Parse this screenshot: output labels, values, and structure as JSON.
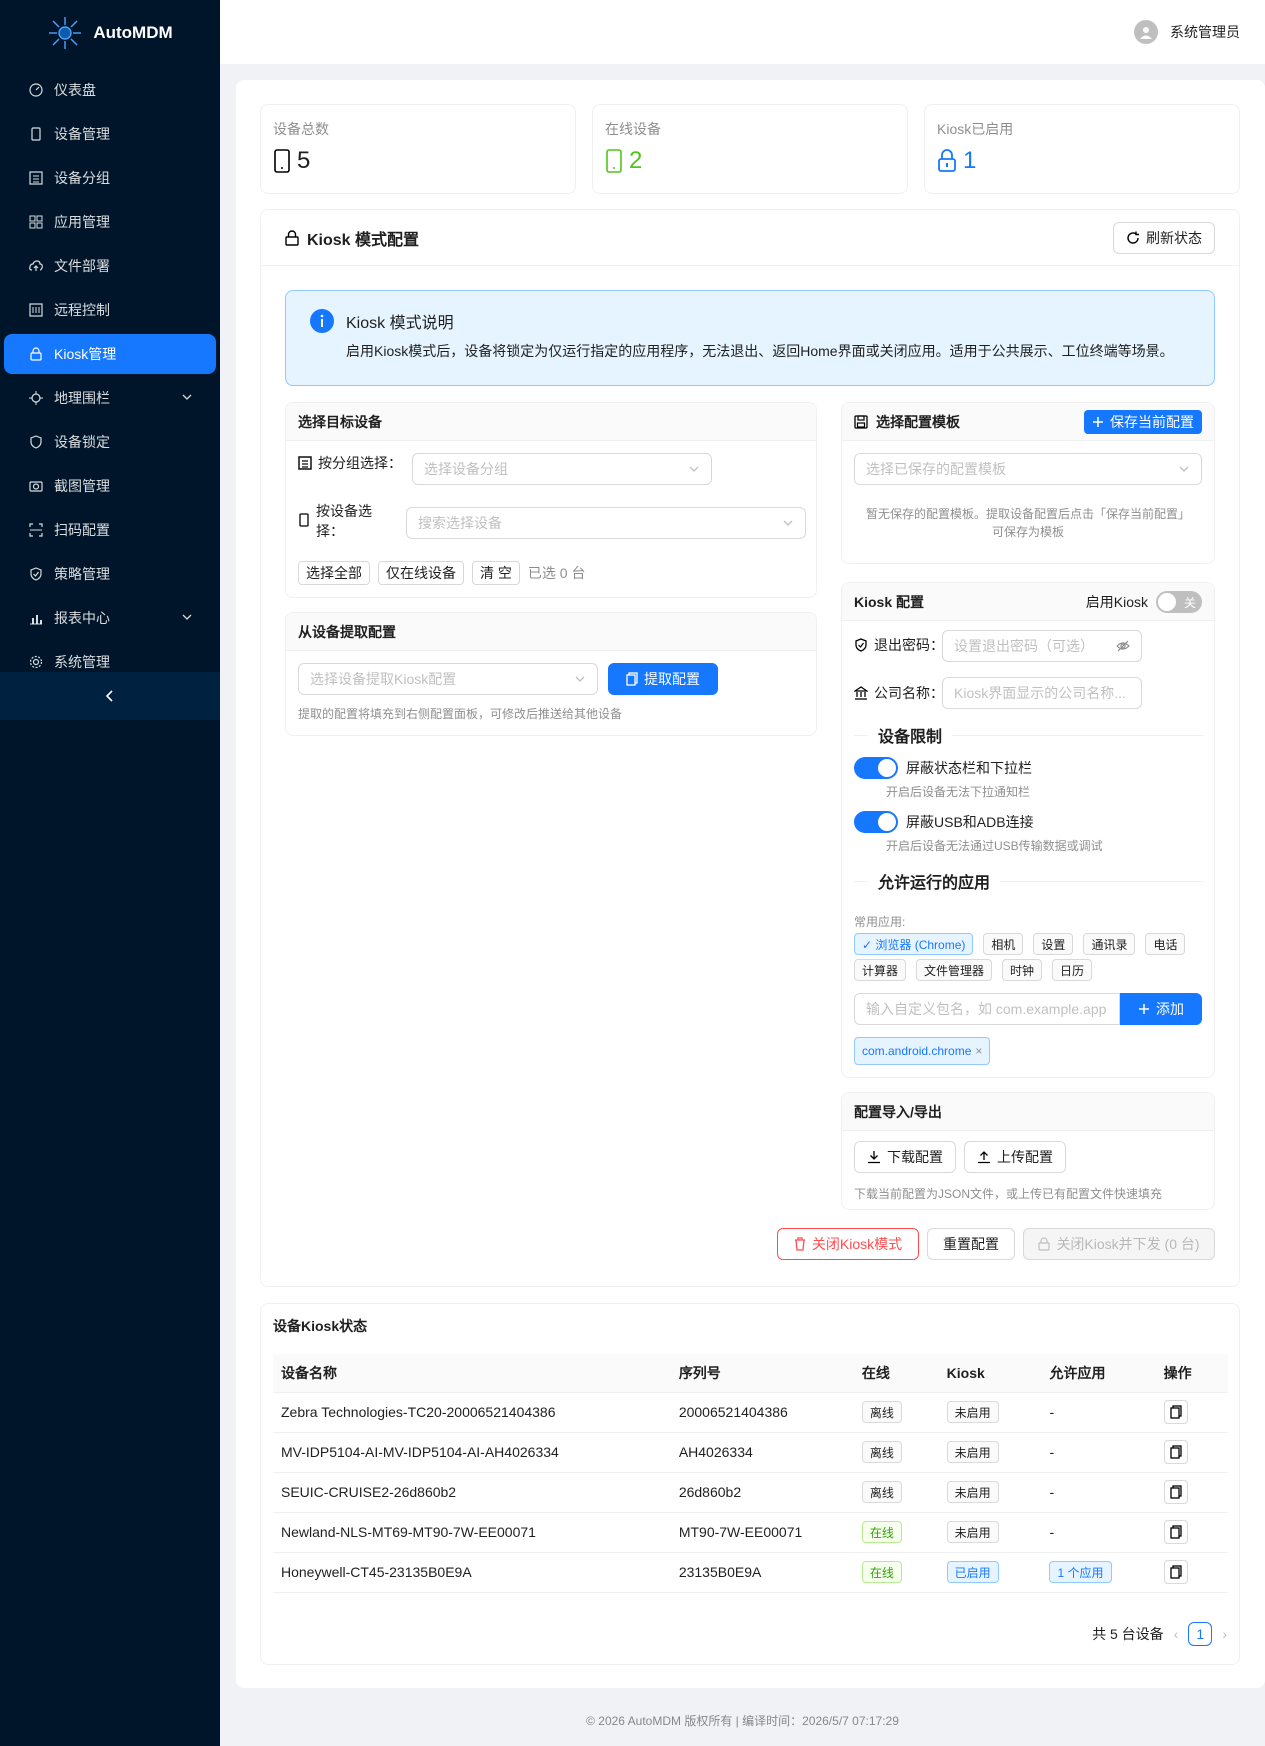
{
  "app": {
    "name": "AutoMDM"
  },
  "header": {
    "user_name": "系统管理员"
  },
  "sidebar": {
    "items": [
      {
        "label": "仪表盘",
        "icon": "dashboard-icon"
      },
      {
        "label": "设备管理",
        "icon": "mobile-icon"
      },
      {
        "label": "设备分组",
        "icon": "group-icon"
      },
      {
        "label": "应用管理",
        "icon": "appstore-icon"
      },
      {
        "label": "文件部署",
        "icon": "cloud-upload-icon"
      },
      {
        "label": "远程控制",
        "icon": "control-icon"
      },
      {
        "label": "Kiosk管理",
        "icon": "lock-icon",
        "active": true
      },
      {
        "label": "地理围栏",
        "icon": "aim-icon",
        "expandable": true
      },
      {
        "label": "设备锁定",
        "icon": "safety-icon"
      },
      {
        "label": "截图管理",
        "icon": "camera-icon"
      },
      {
        "label": "扫码配置",
        "icon": "scan-icon"
      },
      {
        "label": "策略管理",
        "icon": "safety-certificate-icon"
      },
      {
        "label": "报表中心",
        "icon": "bar-chart-icon",
        "expandable": true
      },
      {
        "label": "系统管理",
        "icon": "setting-icon"
      }
    ]
  },
  "stats": {
    "total": {
      "title": "设备总数",
      "value": "5"
    },
    "online": {
      "title": "在线设备",
      "value": "2",
      "color": "#52c41a"
    },
    "kiosk": {
      "title": "Kiosk已启用",
      "value": "1",
      "color": "#1677ff"
    }
  },
  "kiosk_panel": {
    "title": "Kiosk 模式配置",
    "refresh_label": "刷新状态",
    "info_title": "Kiosk 模式说明",
    "info_text": "启用Kiosk模式后，设备将锁定为仅运行指定的应用程序，无法退出、返回Home界面或关闭应用。适用于公共展示、工位终端等场景。"
  },
  "target": {
    "title": "选择目标设备",
    "by_group_label": "按分组选择：",
    "by_group_placeholder": "选择设备分组",
    "by_device_label": "按设备选择：",
    "by_device_placeholder": "搜索选择设备",
    "select_all": "选择全部",
    "online_only": "仅在线设备",
    "clear": "清 空",
    "selected_count": "已选 0 台"
  },
  "extract": {
    "title": "从设备提取配置",
    "placeholder": "选择设备提取Kiosk配置",
    "button": "提取配置",
    "hint": "提取的配置将填充到右侧配置面板，可修改后推送给其他设备"
  },
  "template": {
    "title": "选择配置模板",
    "save_button": "保存当前配置",
    "placeholder": "选择已保存的配置模板",
    "empty_hint_1": "暂无保存的配置模板。提取设备配置后点击「保存当前配置」",
    "empty_hint_2": "可保存为模板"
  },
  "config": {
    "title": "Kiosk 配置",
    "enable_label": "启用Kiosk",
    "enable_state": "关",
    "exit_pw_label": "退出密码：",
    "exit_pw_placeholder": "设置退出密码（可选）",
    "company_label": "公司名称：",
    "company_placeholder": "Kiosk界面显示的公司名称...",
    "restrictions_title": "设备限制",
    "restrict_statusbar": "屏蔽状态栏和下拉栏",
    "restrict_statusbar_hint": "开启后设备无法下拉通知栏",
    "restrict_usb": "屏蔽USB和ADB连接",
    "restrict_usb_hint": "开启后设备无法通过USB传输数据或调试",
    "apps_title": "允许运行的应用",
    "common_apps_label": "常用应用:",
    "common_apps": [
      "✓ 浏览器 (Chrome)",
      "相机",
      "设置",
      "通讯录",
      "电话",
      "计算器",
      "文件管理器",
      "时钟",
      "日历"
    ],
    "pkg_placeholder": "输入自定义包名，如 com.example.app",
    "add_button": "添加",
    "selected_pkg": "com.android.chrome"
  },
  "io": {
    "title": "配置导入/导出",
    "download": "下载配置",
    "upload": "上传配置",
    "hint": "下载当前配置为JSON文件，或上传已有配置文件快速填充"
  },
  "actions": {
    "close_kiosk": "关闭Kiosk模式",
    "reset": "重置配置",
    "close_push": "关闭Kiosk并下发 (0 台)"
  },
  "status_table": {
    "title": "设备Kiosk状态",
    "columns": [
      "设备名称",
      "序列号",
      "在线",
      "Kiosk",
      "允许应用",
      "操作"
    ],
    "rows": [
      {
        "name": "Zebra Technologies-TC20-20006521404386",
        "serial": "20006521404386",
        "online": "离线",
        "kiosk": "未启用",
        "apps": "-"
      },
      {
        "name": "MV-IDP5104-AI-MV-IDP5104-AI-AH4026334",
        "serial": "AH4026334",
        "online": "离线",
        "kiosk": "未启用",
        "apps": "-"
      },
      {
        "name": "SEUIC-CRUISE2-26d860b2",
        "serial": "26d860b2",
        "online": "离线",
        "kiosk": "未启用",
        "apps": "-"
      },
      {
        "name": "Newland-NLS-MT69-MT90-7W-EE00071",
        "serial": "MT90-7W-EE00071",
        "online": "在线",
        "kiosk": "未启用",
        "apps": "-"
      },
      {
        "name": "Honeywell-CT45-23135B0E9A",
        "serial": "23135B0E9A",
        "online": "在线",
        "kiosk": "已启用",
        "apps": "1 个应用"
      }
    ],
    "total_text": "共 5 台设备",
    "page": "1"
  },
  "footer": {
    "text": "© 2026 AutoMDM 版权所有 | 编译时间：2026/5/7 07:17:29"
  }
}
